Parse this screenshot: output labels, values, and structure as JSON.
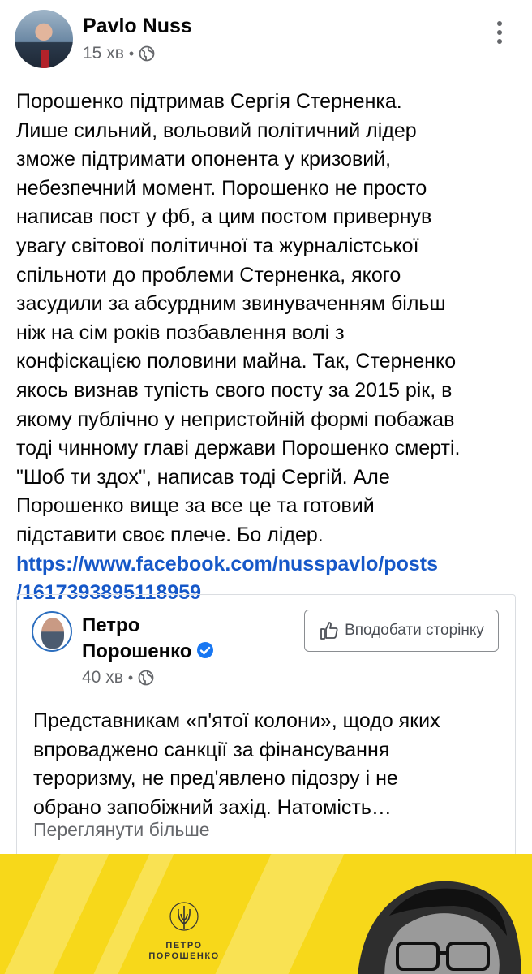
{
  "post": {
    "author": "Pavlo Nuss",
    "time": "15 хв",
    "separator": "•",
    "text": "Порошенко підтримав Сергія Стерненка.\nЛише сильний, вольовий політичний лідер\nзможе підтримати опонента у кризовий,\nнебезпечний момент. Порошенко не просто\nнаписав пост у фб, а цим постом привернув\nувагу світової політичної та журналістської\nспільноти до проблеми Стерненка, якого\nзасудили за абсурдним звинуваченням більш\nніж на сім років позбавлення волі з\nконфіскацією половини майна. Так, Стерненко\nякось визнав тупість свого посту за 2015 рік, в\nякому публічно у непристойній формі побажав\nтоді чинному главі держави Порошенко смерті.\n\"Шоб ти здох\", написав тоді Сергій. Але\nПорошенко вище за все це та готовий\nпідставити своє плече. Бо лідер.",
    "link": "https://www.facebook.com/nusspavlo/posts\n/1617393895118959"
  },
  "shared_post": {
    "page_name_line1": "Петро",
    "page_name_line2": "Порошенко",
    "time": "40 хв",
    "separator": "•",
    "like_button": "Вподобати сторінку",
    "text": "Представникам «п'ятої колони», щодо яких\nвпроваджено санкції за фінансування\nтероризму, не пред'явлено підозру і не\nобрано запобіжний захід. Натомість…",
    "see_more": "Переглянути більше"
  },
  "banner": {
    "logo_line1": "ПЕТРО",
    "logo_line2": "ПОРОШЕНКО",
    "background_color": "#f7d81a"
  },
  "icons": [
    "globe-icon",
    "more-options-icon",
    "verified-badge-icon",
    "thumbs-up-icon",
    "trident-icon"
  ],
  "colors": {
    "link": "#1658c8",
    "meta": "#65676b",
    "verified": "#1877f2"
  }
}
